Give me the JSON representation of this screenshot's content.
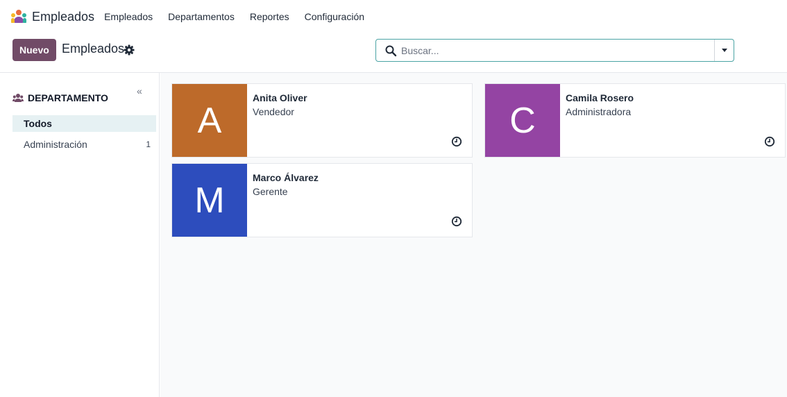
{
  "topnav": {
    "app_name": "Empleados",
    "menu": [
      "Empleados",
      "Departamentos",
      "Reportes",
      "Configuración"
    ]
  },
  "control": {
    "new_label": "Nuevo",
    "title": "Empleados",
    "search_placeholder": "Buscar..."
  },
  "sidebar": {
    "heading": "DEPARTAMENTO",
    "collapse_glyph": "«",
    "items": [
      {
        "label": "Todos",
        "count": ""
      },
      {
        "label": "Administración",
        "count": "1"
      }
    ]
  },
  "employees": [
    {
      "initial": "A",
      "name": "Anita Oliver",
      "job": "Vendedor",
      "color": "#bd6a2a"
    },
    {
      "initial": "C",
      "name": "Camila Rosero",
      "job": "Administradora",
      "color": "#9444a3"
    },
    {
      "initial": "M",
      "name": "Marco Álvarez",
      "job": "Gerente",
      "color": "#2d4dbd"
    }
  ],
  "colors": {
    "brand": "#714b67",
    "search_border": "#4aa3a4",
    "active_item_bg": "#e6f1f3"
  },
  "icons": [
    "app-logo-icon",
    "gear-icon",
    "search-icon",
    "caret-down-icon",
    "people-icon",
    "collapse-icon",
    "clock-icon"
  ]
}
